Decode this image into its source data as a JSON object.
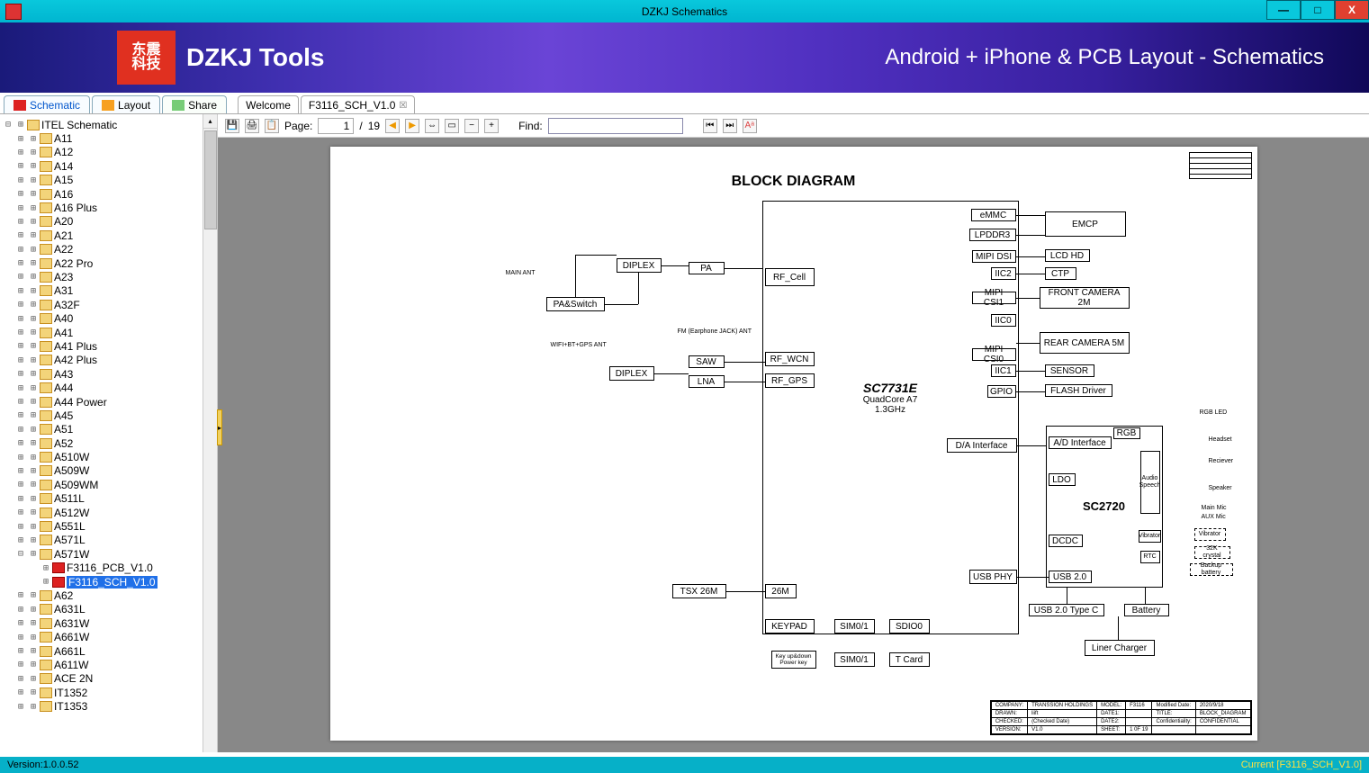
{
  "window": {
    "title": "DZKJ Schematics",
    "min": "—",
    "max": "□",
    "close": "X"
  },
  "banner": {
    "logo1": "东震",
    "logo2": "科技",
    "brand": "DZKJ Tools",
    "slogan": "Android + iPhone & PCB Layout - Schematics"
  },
  "maintabs": {
    "schematic": "Schematic",
    "layout": "Layout",
    "share": "Share"
  },
  "doctabs": {
    "welcome": "Welcome",
    "doc1": "F3116_SCH_V1.0"
  },
  "tree": {
    "root": "ITEL Schematic",
    "items": [
      "A11",
      "A12",
      "A14",
      "A15",
      "A16",
      "A16 Plus",
      "A20",
      "A21",
      "A22",
      "A22 Pro",
      "A23",
      "A31",
      "A32F",
      "A40",
      "A41",
      "A41 Plus",
      "A42 Plus",
      "A43",
      "A44",
      "A44 Power",
      "A45",
      "A51",
      "A52",
      "A510W",
      "A509W",
      "A509WM",
      "A511L",
      "A512W",
      "A551L",
      "A571L",
      "A571W",
      "A62",
      "A631L",
      "A631W",
      "A661W",
      "A661L",
      "A611W",
      "ACE 2N",
      "IT1352",
      "IT1353"
    ],
    "a571w_children": {
      "pcb": "F3116_PCB_V1.0",
      "sch": "F3116_SCH_V1.0"
    }
  },
  "toolbar": {
    "page_label": "Page:",
    "page_cur": "1",
    "page_sep": " / ",
    "page_total": "19",
    "find_label": "Find:"
  },
  "diagram": {
    "title": "BLOCK DIAGRAM",
    "soc_name": "SC7731E",
    "soc_sub1": "QuadCore A7",
    "soc_sub2": "1.3GHz",
    "pmic": "SC2720",
    "main_ant": "MAIN ANT",
    "wifi_ant": "WIFI+BT+GPS ANT",
    "fm_ant": "FM (Earphone JACK) ANT",
    "pa_switch": "PA&Switch",
    "diplex": "DIPLEX",
    "pa": "PA",
    "saw": "SAW",
    "lna": "LNA",
    "rf_cell": "RF_Cell",
    "rf_wcn": "RF_WCN",
    "rf_gps": "RF_GPS",
    "tsx": "TSX 26M",
    "m26": "26M",
    "keypad": "KEYPAD",
    "keypad_sub": "Key up&down\nPower key",
    "sim01_top": "SIM0/1",
    "sdio0": "SDIO0",
    "sim01_bot": "SIM0/1",
    "tcard": "T Card",
    "da": "D/A Interface",
    "usbphy": "USB PHY",
    "emmc": "eMMC",
    "lpddr3": "LPDDR3",
    "mipidsi": "MIPI DSI",
    "iic2": "IIC2",
    "mipicsi1": "MIPI CSI1",
    "iic0": "IIC0",
    "mipicsi0": "MIPI CSI0",
    "iic1": "IIC1",
    "gpio": "GPIO",
    "emcp": "EMCP",
    "lcdhd": "LCD HD",
    "ctp": "CTP",
    "frontcam": "FRONT CAMERA 2M",
    "rearcam": "REAR CAMERA 5M",
    "sensor": "SENSOR",
    "flashdrv": "FLASH Driver",
    "ad": "A/D Interface",
    "rgb": "RGB",
    "ldo": "LDO",
    "dcdc": "DCDC",
    "usb20": "USB 2.0",
    "usbtypec": "USB 2.0 Type C",
    "battery": "Battery",
    "linercharger": "Liner Charger",
    "audio": "Audio Speech",
    "vibrator": "Vibrator",
    "rtc": "RTC",
    "rgbled": "RGB LED",
    "headset": "Headset",
    "receiver": "Reciever",
    "speaker": "Speaker",
    "mainmic": "Main Mic",
    "auxmic": "AUX Mic",
    "vibrator2": "Vibrator",
    "xtal32k": "32K crystal",
    "backupbat": "Backup battery"
  },
  "titleblock": {
    "company_l": "COMPANY:",
    "company": "TRANSSION HOLDINGS",
    "model_l": "MODEL:",
    "model": "F3116",
    "moddate_l": "Modified Date:",
    "moddate": "2020/9/18",
    "drawn_l": "DRAWN:",
    "drawn": "liift",
    "date1_l": "DATE1:",
    "title_l": "TITLE:",
    "title": "BLOCK_DIAGRAM",
    "checked_l": "CHECKED:",
    "checked": "(Checked Date)",
    "date2_l": "DATE2:",
    "conf_l": "Confidentiality:",
    "conf": "CONFIDENTIAL",
    "ver_l": "VERSION:",
    "ver": "V1.0",
    "sheet_l": "SHEET:",
    "sheet": "1 0F 19"
  },
  "status": {
    "left": "Version:1.0.0.52",
    "right": "Current [F3116_SCH_V1.0]"
  }
}
